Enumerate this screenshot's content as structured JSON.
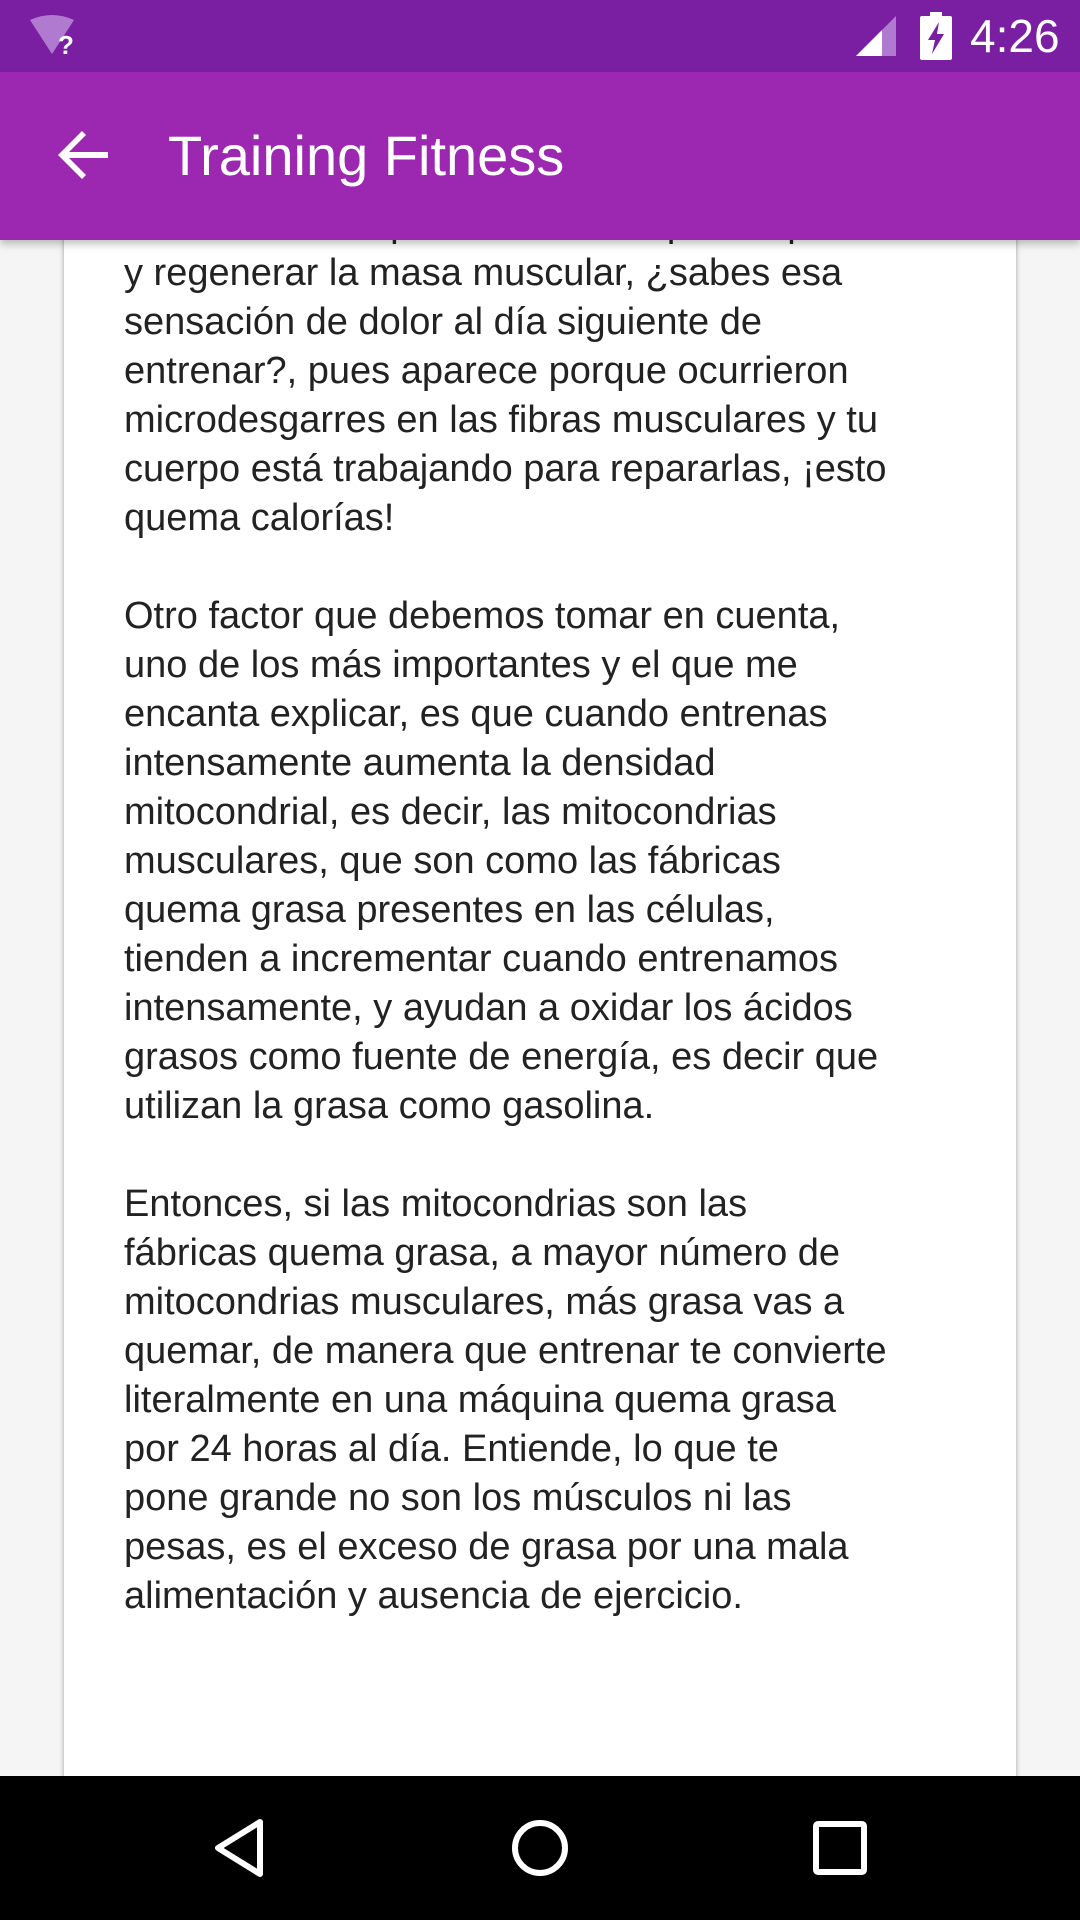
{
  "status_bar": {
    "time": "4:26",
    "wifi_icon": "wifi-unknown-icon",
    "signal_icon": "cell-signal-icon",
    "battery_icon": "battery-charging-icon"
  },
  "toolbar": {
    "title": "Training Fitness",
    "back_icon": "arrow-back-icon"
  },
  "article": {
    "lines": [
      "entrenamiento quemas calorías para reparar",
      "y regenerar la masa muscular, ¿sabes esa",
      "sensación de dolor al día siguiente de",
      "entrenar?, pues aparece porque ocurrieron",
      "microdesgarres en las fibras musculares y tu",
      "cuerpo está trabajando para repararlas, ¡esto",
      "quema calorías!",
      "",
      "Otro factor que debemos tomar en cuenta,",
      "uno de los más importantes y el que me",
      "encanta explicar, es que cuando entrenas",
      "intensamente aumenta la densidad",
      "mitocondrial, es decir, las mitocondrias",
      "musculares, que son como las fábricas",
      "quema grasa presentes en las células,",
      "tienden a incrementar cuando entrenamos",
      "intensamente, y ayudan a oxidar los ácidos",
      "grasos como fuente de energía, es decir que",
      "utilizan la grasa como gasolina.",
      "",
      "Entonces, si las mitocondrias son las",
      "fábricas quema grasa, a mayor número de",
      "mitocondrias musculares, más grasa vas a",
      "quemar, de manera que entrenar te convierte",
      "literalmente en una máquina quema grasa",
      "por 24 horas al día. Entiende, lo que te",
      "pone grande no son los músculos ni las",
      "pesas, es el exceso de grasa por una mala",
      "alimentación y ausencia de ejercicio."
    ]
  },
  "nav_bar": {
    "back_icon": "nav-back-icon",
    "home_icon": "nav-home-icon",
    "recents_icon": "nav-recents-icon"
  },
  "colors": {
    "status_bar": "#7b1fa2",
    "toolbar": "#9c27b0",
    "text": "#222222",
    "background": "#f5f5f5",
    "card": "#ffffff",
    "nav_bar": "#000000"
  }
}
